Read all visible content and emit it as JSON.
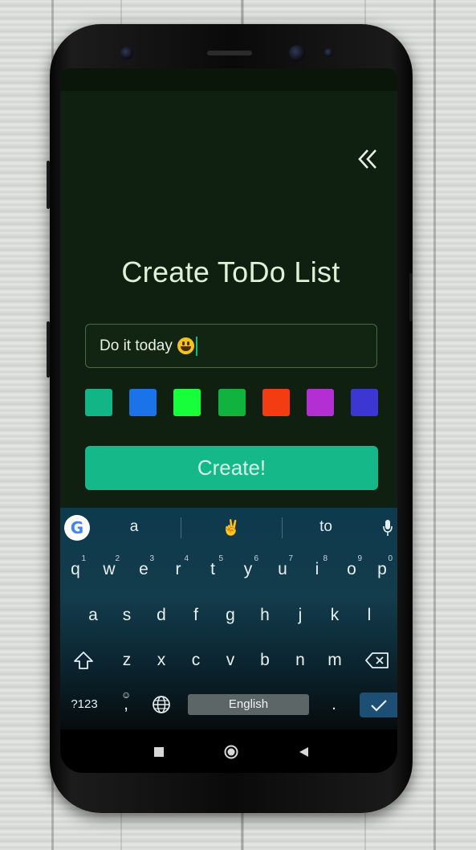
{
  "app": {
    "title": "Create ToDo List",
    "input": {
      "value": "Do it today",
      "emoji": "smiley-emoji"
    },
    "color_swatches": [
      "#12b585",
      "#1a73e8",
      "#17ff3b",
      "#0fb33e",
      "#f43c13",
      "#b32fd3",
      "#3c37d2"
    ],
    "create_label": "Create!",
    "back_icon": "double-chevron-left-icon",
    "colors": {
      "background": "#0f1f10",
      "accent": "#15b889",
      "title": "#dff2d8"
    }
  },
  "keyboard": {
    "suggestions": [
      "a",
      "✌",
      "to"
    ],
    "row1": [
      {
        "k": "q",
        "n": "1"
      },
      {
        "k": "w",
        "n": "2"
      },
      {
        "k": "e",
        "n": "3"
      },
      {
        "k": "r",
        "n": "4"
      },
      {
        "k": "t",
        "n": "5"
      },
      {
        "k": "y",
        "n": "6"
      },
      {
        "k": "u",
        "n": "7"
      },
      {
        "k": "i",
        "n": "8"
      },
      {
        "k": "o",
        "n": "9"
      },
      {
        "k": "p",
        "n": "0"
      }
    ],
    "row2": [
      "a",
      "s",
      "d",
      "f",
      "g",
      "h",
      "j",
      "k",
      "l"
    ],
    "row3": [
      "z",
      "x",
      "c",
      "v",
      "b",
      "n",
      "m"
    ],
    "symbols_label": "?123",
    "emoji_key": ",",
    "space_label": "English",
    "period_label": ".",
    "icons": [
      "google-icon",
      "mic-icon",
      "shift-icon",
      "backspace-icon",
      "emoji-icon",
      "globe-icon",
      "check-icon"
    ]
  },
  "navbar": {
    "icons": [
      "recents-icon",
      "home-icon",
      "back-icon"
    ]
  }
}
